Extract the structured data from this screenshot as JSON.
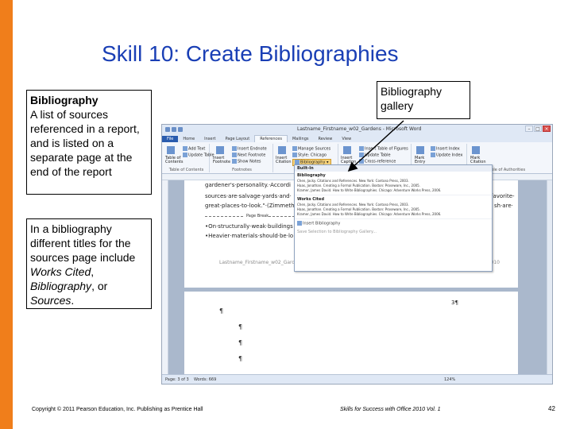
{
  "slide": {
    "title": "Skill 10: Create Bibliographies",
    "accent_color": "#f07e1b",
    "title_color": "#1a3fb5",
    "copyright": "Copyright © 2011 Pearson Education, Inc. Publishing as Prentice Hall",
    "book": "Skills for Success with Office 2010 Vol. 1",
    "page_number": "42"
  },
  "callouts": {
    "bib_heading": "Bibliography",
    "bib_body": "A list of sources referenced in a report, and is listed on a separate page at the end of the report",
    "titles_prefix": "In a bibliography different titles for the sources page include ",
    "titles_works": "Works Cited",
    "titles_sep1": ", ",
    "titles_bib": "Bibliography",
    "titles_sep2": ", or ",
    "titles_src": "Sources",
    "titles_end": ".",
    "gallery_label": "Bibliography gallery"
  },
  "word": {
    "window_title": "Lastname_Firstname_w02_Gardens - Microsoft Word",
    "tabs": [
      "File",
      "Home",
      "Insert",
      "Page Layout",
      "References",
      "Mailings",
      "Review",
      "View"
    ],
    "ribbon": {
      "toc_label": "Table of Contents",
      "toc_group": "Table of Contents",
      "add_text": "Add Text",
      "update_table": "Update Table",
      "insert_endnote": "Insert Endnote",
      "next_footnote": "Next Footnote",
      "show_notes": "Show Notes",
      "insert_footnote": "Insert Footnote",
      "footnotes_group": "Footnotes",
      "insert_citation": "Insert Citation",
      "manage_sources": "Manage Sources",
      "style_label": "Style: Chicago",
      "bibliography_btn": "Bibliography",
      "citations_group": "Citati",
      "insert_caption": "Insert Caption",
      "insert_table_figures": "Insert Table of Figures",
      "update_table2": "Update Table",
      "cross_reference": "Cross-reference",
      "mark_entry": "Mark Entry",
      "insert_index": "Insert Index",
      "update_index": "Update Index",
      "mark_citation": "Mark Citation",
      "toa_group": "Table of Authorities"
    },
    "doc": {
      "line1": "gardener's·personality.·Accordi",
      "line2": "sources·are·salvage·yards·and·",
      "line3": "great-places-to-look.\"·(Zimmeth",
      "right1": "favorite-",
      "right2": "sh·are·",
      "page_break": "Page Break",
      "line4": "•On·structurally·weak·buildings",
      "line5": "•Heavier·materials·should·be·lo",
      "footer_left": "Lastname_Firstname_w02_Garde",
      "footer_right": "0/9/2010",
      "page2_num": "3¶",
      "pilcrow": "¶"
    },
    "gallery": {
      "builtin": "Built-In",
      "bibliography_title": "Bibliography",
      "works_cited_title": "Works Cited",
      "entries": [
        "Chen, Jacky. Citations and References. New York: Contoso Press, 2003.",
        "Haas, Jonathan. Creating a Formal Publication. Boston: Proseware, Inc., 2005.",
        "Kramer, James David. How to Write Bibliographies. Chicago: Adventure Works Press, 2006."
      ],
      "insert_bibliography": "Insert Bibliography",
      "save_selection": "Save Selection to Bibliography Gallery..."
    },
    "status": {
      "page": "Page: 3 of 3",
      "words": "Words: 669",
      "zoom": "124%"
    }
  }
}
